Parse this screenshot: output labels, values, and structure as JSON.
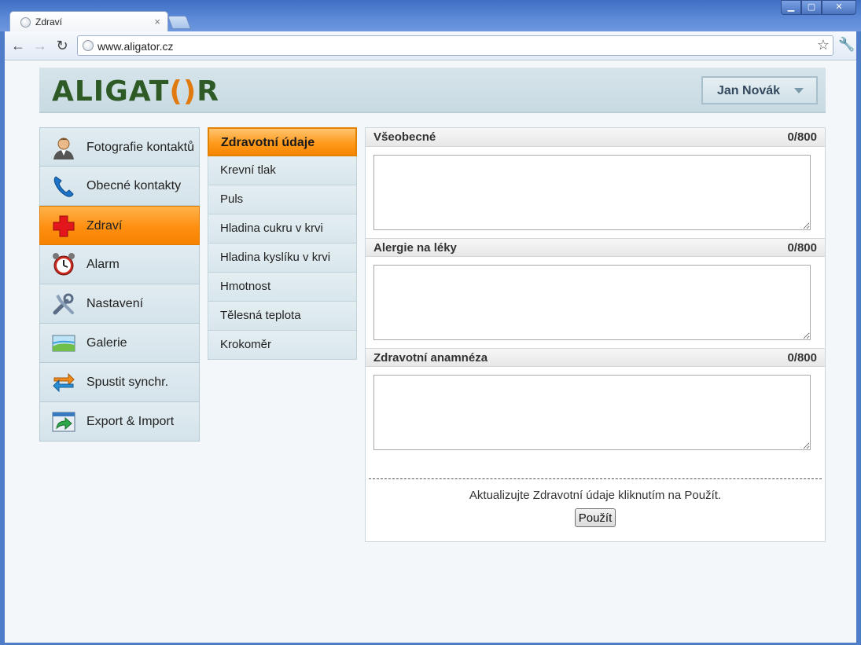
{
  "browser": {
    "tab_title": "Zdraví",
    "tab_close": "×",
    "url": "www.aligator.cz",
    "window_buttons": [
      "▁",
      "▢",
      "✕"
    ]
  },
  "header": {
    "logo_pre": "ALIGAT",
    "logo_o": "()",
    "logo_post": "R",
    "user_name": "Jan Novák"
  },
  "left_nav": [
    {
      "label": "Fotografie kontaktů",
      "icon": "contact-photo-icon"
    },
    {
      "label": "Obecné kontakty",
      "icon": "phone-icon"
    },
    {
      "label": "Zdraví",
      "icon": "health-cross-icon",
      "active": true
    },
    {
      "label": "Alarm",
      "icon": "alarm-clock-icon"
    },
    {
      "label": "Nastavení",
      "icon": "tools-icon"
    },
    {
      "label": "Galerie",
      "icon": "gallery-icon"
    },
    {
      "label": "Spustit synchr.",
      "icon": "sync-icon"
    },
    {
      "label": "Export & Import",
      "icon": "export-import-icon"
    }
  ],
  "sub_nav": [
    {
      "label": "Zdravotní údaje",
      "active": true
    },
    {
      "label": "Krevní tlak"
    },
    {
      "label": "Puls"
    },
    {
      "label": "Hladina cukru v krvi"
    },
    {
      "label": "Hladina kyslíku v krvi"
    },
    {
      "label": "Hmotnost"
    },
    {
      "label": "Tělesná teplota"
    },
    {
      "label": "Krokoměr"
    }
  ],
  "sections": [
    {
      "title": "Všeobecné",
      "count": "0/800",
      "value": ""
    },
    {
      "title": "Alergie na léky",
      "count": "0/800",
      "value": ""
    },
    {
      "title": "Zdravotní anamnéza",
      "count": "0/800",
      "value": ""
    }
  ],
  "hint": "Aktualizujte Zdravotní údaje kliknutím na Použít.",
  "apply_label": "Použít",
  "colors": {
    "accent": "#ff9a1d",
    "logo_green": "#2e5a26",
    "logo_orange": "#e07a0f"
  }
}
